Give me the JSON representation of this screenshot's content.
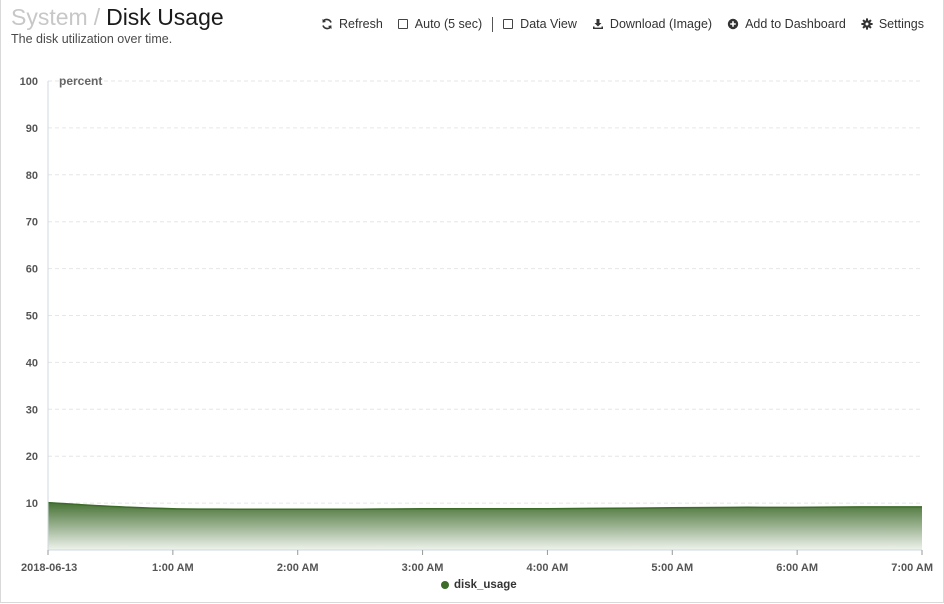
{
  "header": {
    "breadcrumb_parent": "System",
    "breadcrumb_separator": "/",
    "title": "Disk Usage",
    "subtitle": "The disk utilization over time."
  },
  "toolbar": {
    "refresh_label": "Refresh",
    "refresh_icon": "refresh-icon",
    "auto_label": "Auto (5 sec)",
    "auto_checked": false,
    "data_view_label": "Data View",
    "data_view_checked": false,
    "download_label": "Download (Image)",
    "download_icon": "download-icon",
    "add_dashboard_label": "Add to Dashboard",
    "add_dashboard_icon": "plus-circle-icon",
    "settings_label": "Settings",
    "settings_icon": "gear-icon"
  },
  "chart_data": {
    "type": "area",
    "ylabel": "percent",
    "ylim": [
      0,
      100
    ],
    "yticks": [
      10,
      20,
      30,
      40,
      50,
      60,
      70,
      80,
      90,
      100
    ],
    "xticks": [
      "2018-06-13",
      "1:00 AM",
      "2:00 AM",
      "3:00 AM",
      "4:00 AM",
      "5:00 AM",
      "6:00 AM",
      "7:00 AM"
    ],
    "x": [
      "00:00",
      "00:30",
      "01:00",
      "01:30",
      "02:00",
      "02:30",
      "03:00",
      "03:30",
      "04:00",
      "04:30",
      "05:00",
      "05:30",
      "06:00",
      "06:30",
      "07:00"
    ],
    "series": [
      {
        "name": "disk_usage",
        "color": "#3d6b2a",
        "values": [
          10.1,
          9.3,
          8.8,
          8.7,
          8.7,
          8.7,
          8.8,
          8.8,
          8.8,
          8.9,
          9.0,
          9.1,
          9.1,
          9.2,
          9.2
        ]
      }
    ],
    "grid": true,
    "legend_position": "bottom-center"
  }
}
